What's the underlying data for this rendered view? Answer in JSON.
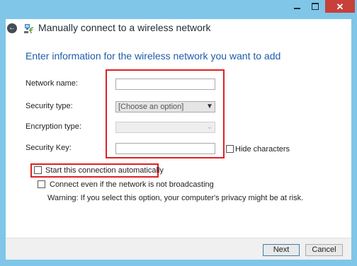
{
  "window": {
    "close_glyph": "✕"
  },
  "nav": {
    "back_glyph": "←",
    "title": "Manually connect to a wireless network"
  },
  "form": {
    "heading": "Enter information for the wireless network you want to add",
    "network_name": {
      "label": "Network name:",
      "value": ""
    },
    "security_type": {
      "label": "Security type:",
      "value": "[Choose an option]"
    },
    "encryption_type": {
      "label": "Encryption type:",
      "value": ""
    },
    "security_key": {
      "label": "Security Key:",
      "value": ""
    },
    "hide_characters": {
      "label": "Hide characters",
      "checked": false
    },
    "start_automatically": {
      "label": "Start this connection automatically",
      "checked": false
    },
    "connect_not_broadcasting": {
      "label": "Connect even if the network is not broadcasting",
      "checked": false
    },
    "warning": "Warning: If you select this option, your computer's privacy might be at risk."
  },
  "footer": {
    "next_label": "Next",
    "cancel_label": "Cancel"
  },
  "colors": {
    "title_bar": "#7fc6e9",
    "heading_text": "#1f5ca8",
    "highlight_box": "#e02020",
    "close_button": "#c7403a"
  },
  "icons": {
    "back": "back-arrow-icon",
    "network": "wireless-network-icon",
    "dropdown": "chevron-down-icon"
  }
}
